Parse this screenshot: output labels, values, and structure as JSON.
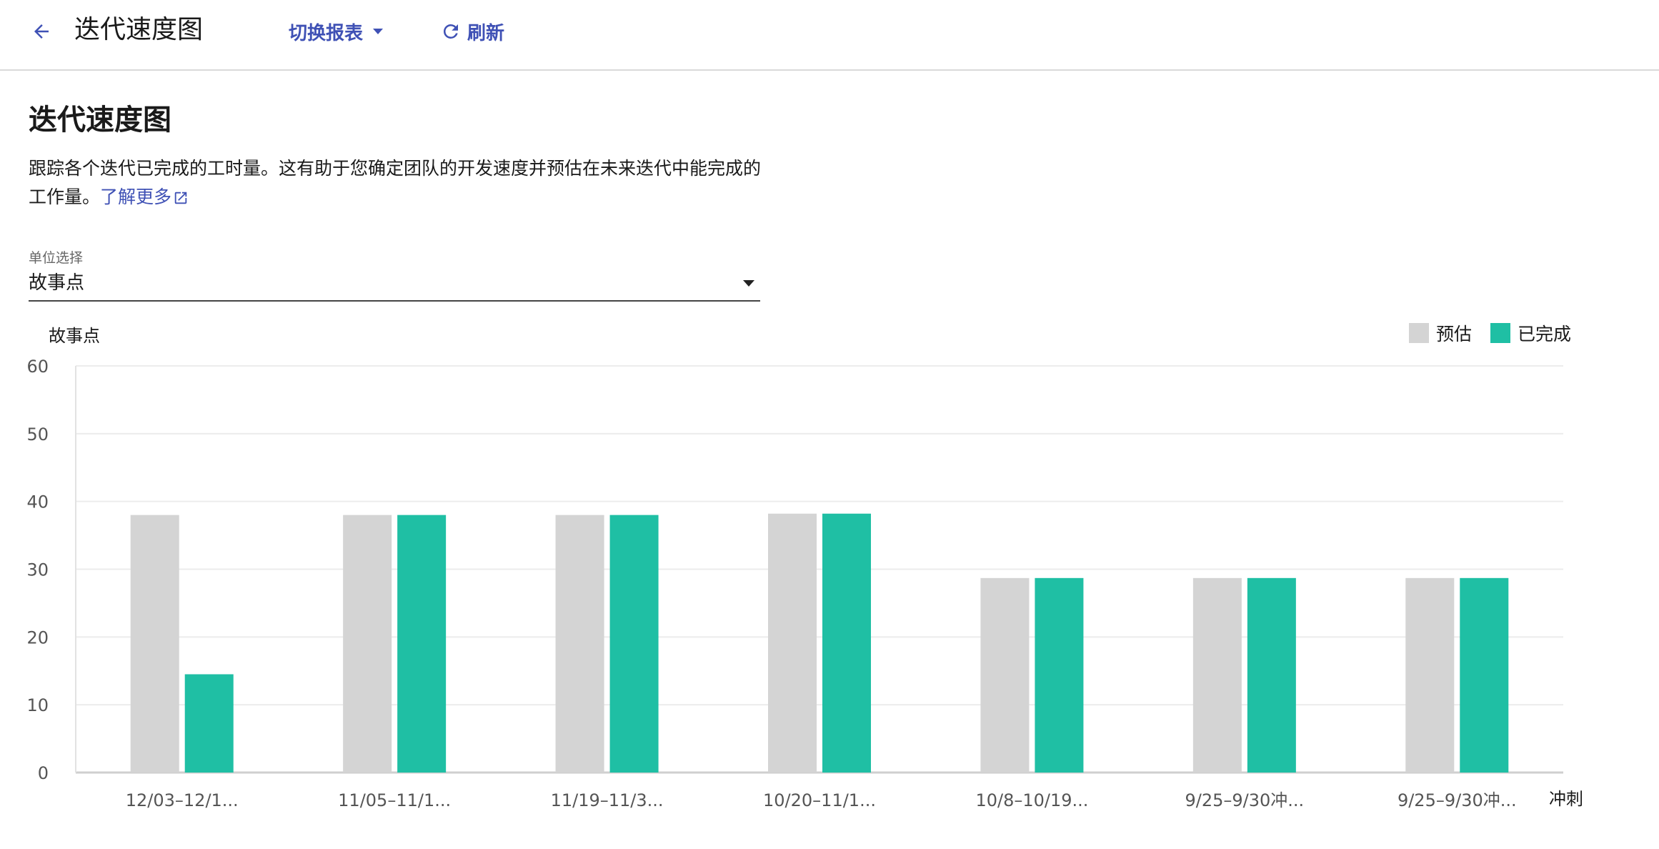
{
  "header": {
    "title": "迭代速度图",
    "switch_label": "切换报表",
    "refresh_label": "刷新",
    "back_icon": "arrow-left-icon",
    "switch_icon": "caret-down-icon",
    "refresh_icon": "refresh-icon"
  },
  "main": {
    "title": "迭代速度图",
    "description": "跟踪各个迭代已完成的工时量。这有助于您确定团队的开发速度并预估在未来迭代中能完成的工作量。",
    "learn_more": "了解更多",
    "learn_more_icon": "external-link-icon"
  },
  "unit_select": {
    "label": "单位选择",
    "value": "故事点"
  },
  "colors": {
    "accent": "#3f51b5",
    "estimated": "#d4d4d4",
    "completed": "#1fbfa4"
  },
  "chart_data": {
    "type": "bar",
    "ylabel": "故事点",
    "xlabel": "冲刺",
    "ylim": [
      0,
      60
    ],
    "yticks": [
      0,
      10,
      20,
      30,
      40,
      50,
      60
    ],
    "grid": true,
    "legend_position": "top-right",
    "categories": [
      "12/03–12/1...",
      "11/05–11/1...",
      "11/19–11/3...",
      "10/20–11/1...",
      "10/8–10/19...",
      "9/25–9/30冲...",
      "9/25–9/30冲..."
    ],
    "series": [
      {
        "name": "预估",
        "color": "#d4d4d4",
        "values": [
          38,
          38,
          38,
          38.2,
          28.7,
          28.7,
          28.7
        ]
      },
      {
        "name": "已完成",
        "color": "#1fbfa4",
        "values": [
          14.5,
          38,
          38,
          38.2,
          28.7,
          28.7,
          28.7
        ]
      }
    ]
  }
}
